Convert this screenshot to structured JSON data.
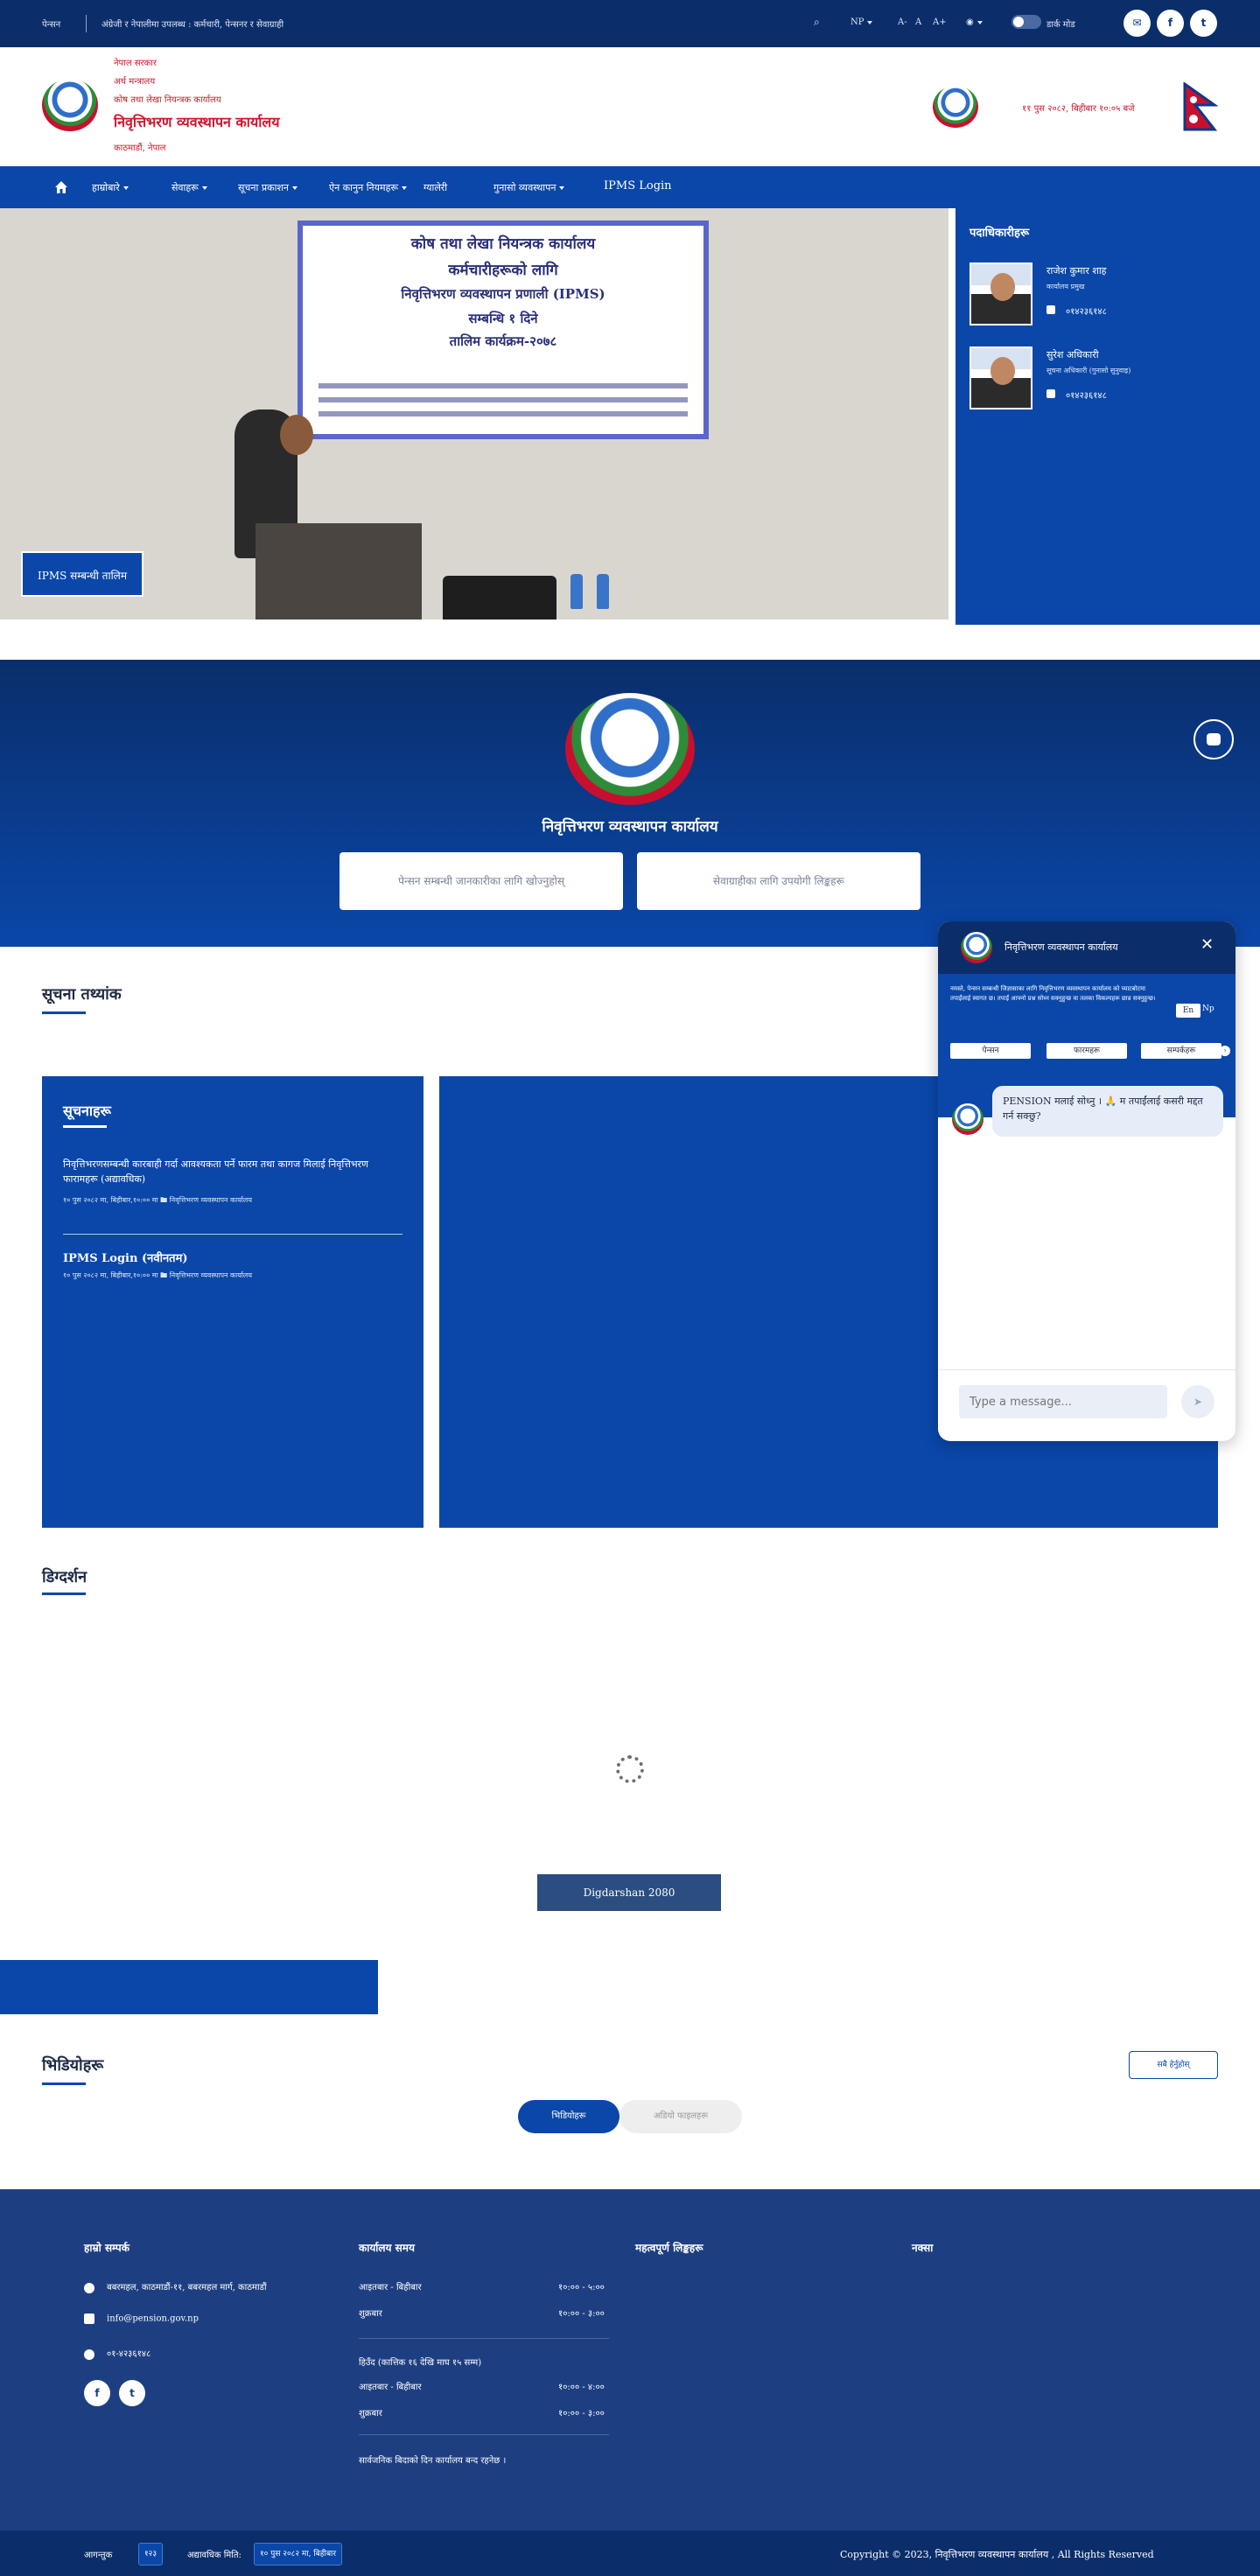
{
  "topbar": {
    "org_short": "पेन्सन",
    "notice": "अंग्रेजी र नेपालीमा उपलब्ध : कर्मचारी, पेन्सनर र सेवाग्राही",
    "lang": "NP",
    "font_minus": "A-",
    "font_normal": "A",
    "font_plus": "A+",
    "theme_label": "डार्क मोड",
    "mail_icon": "mail-icon",
    "facebook_icon": "facebook-icon",
    "twitter_icon": "twitter-icon"
  },
  "header": {
    "line1": "नेपाल सरकार",
    "line2": "अर्थ मन्त्रालय",
    "line3": "कोष तथा लेखा नियन्त्रक कार्यालय",
    "title": "निवृत्तिभरण व्यवस्थापन कार्यालय",
    "line5": "काठमाडौं, नेपाल",
    "date_time": "११ पुस २०८२, बिहीबार १०:०५ बजे"
  },
  "nav": {
    "home_icon": "home-icon",
    "items": [
      {
        "label": "हाम्रोबारे",
        "dropdown": true
      },
      {
        "label": "सेवाहरू",
        "dropdown": true
      },
      {
        "label": "सूचना प्रकाशन",
        "dropdown": true
      },
      {
        "label": "ऐन कानुन नियमहरू",
        "dropdown": true
      },
      {
        "label": "ग्यालेरी",
        "dropdown": false
      },
      {
        "label": "गुनासो व्यवस्थापन",
        "dropdown": true
      },
      {
        "label": "IPMS Login",
        "dropdown": false
      }
    ]
  },
  "hero": {
    "banner_line1": "कोष तथा लेखा नियन्त्रक कार्यालय",
    "banner_line2": "कर्मचारीहरूको लागि",
    "banner_line3": "निवृत्तिभरण व्यवस्थापन प्रणाली (IPMS)",
    "banner_line4": "सम्बन्धि १ दिने",
    "banner_line5": "तालिम कार्यक्रम-२०७८",
    "caption": "IPMS सम्बन्धी तालिम"
  },
  "officials": {
    "title": "पदाधिकारीहरू",
    "people": [
      {
        "name": "राजेश कुमार शाह",
        "role": "कार्यालय प्रमुख",
        "phone": "०१४२३६१४८"
      },
      {
        "name": "सुरेश अधिकारी",
        "role": "सूचना अधिकारी (गुनासो सुनुवाइ)",
        "phone": "०१४२३६१४८"
      }
    ]
  },
  "search_section": {
    "title": "निवृत्तिभरण व्यवस्थापन कार्यालय",
    "box1": "पेन्सन सम्बन्धी जानकारीका लागि खोज्नुहोस्",
    "box2": "सेवाग्राहीका लागि उपयोगी लिङ्कहरू",
    "chat_icon": "chatbot-icon"
  },
  "news": {
    "title": "सूचना तथ्यांक",
    "card_title": "सूचनाहरू",
    "items": [
      {
        "title": "निवृत्तिभरणसम्बन्धी कारबाही गर्दा आवश्यकता पर्ने फारम तथा कागज मिलाई निवृत्तिभरण फारामहरू (अद्यावधिक)",
        "date": "१० पुस २०८२ मा, बिहीबार,१०:०० मा",
        "source": "निवृत्तिभरण व्यवस्थापन कार्यालय"
      },
      {
        "title": "IPMS Login (नवीनतम)",
        "date": "१० पुस २०८२ मा, बिहीबार,१०:०० मा",
        "source": "निवृत्तिभरण व्यवस्थापन कार्यालय"
      }
    ]
  },
  "gallery": {
    "title": "डिग्दर्शन",
    "button": "Digdarshan 2080"
  },
  "videos": {
    "title": "भिडियोहरू",
    "view_all": "सबै हेर्नुहोस्",
    "tab_active": "भिडियोहरू",
    "tab_inactive": "अडियो फाइलहरू"
  },
  "chat": {
    "title": "निवृत्तिभरण व्यवस्थापन कार्यालय",
    "intro": "नमस्ते, पेन्सन सम्बन्धी जिज्ञासाका लागि निवृत्तिभरण व्यवस्थापन कार्यालय को च्याटबोटमा तपाईंलाई स्वागत छ। तपाईं आफ्नो प्रश्न सोध्न सक्नुहुन्छ वा तलका विकल्पहरू छान्न सक्नुहुन्छ।",
    "lang_en": "En",
    "lang_np": "Np",
    "options": [
      "पेन्सन",
      "फारमहरू",
      "सम्पर्कहरू"
    ],
    "greeting": "PENSION मलाई सोध्नु । 🙏 म तपाईंलाई कसरी मद्दत गर्न सक्छु?",
    "placeholder": "Type a message...",
    "send_icon": "send-icon",
    "close_icon": "close-icon"
  },
  "footer": {
    "col1_title": "हाम्रो सम्पर्क",
    "address": "बबरमहल, काठमाडौं-११, बबरमहल मार्ग, काठमाडौं",
    "email": "info@pension.gov.np",
    "phone": "०१-४२३६१४८",
    "col2_title": "कार्यालय समय",
    "hours": [
      {
        "day": "आइतबार - बिहीबार",
        "time": "१०:०० - ५:००"
      },
      {
        "day": "शुक्रबार",
        "time": "१०:०० - ३:००"
      }
    ],
    "winter_title": "हिउँद (कात्तिक १६ देखि माघ १५ सम्म)",
    "winter_hours": [
      {
        "day": "आइतबार - बिहीबार",
        "time": "१०:०० - ४:००"
      },
      {
        "day": "शुक्रबार",
        "time": "१०:०० - ३:००"
      }
    ],
    "holiday_note": "सार्वजनिक बिदाको दिन कार्यालय बन्द रहनेछ ।",
    "col3_title": "महत्वपूर्ण लिङ्कहरू",
    "col4_title": "नक्सा"
  },
  "bottombar": {
    "visitors_label": "आगन्तुक",
    "visitors_value": "१२३",
    "updated_label": "अद्यावधिक मिति:",
    "updated_value": "१० पुस २०८२ मा, बिहीबार",
    "copyright": "Copyright © 2023, निवृत्तिभरण व्यवस्थापन कार्यालय , All Rights Reserved"
  },
  "colors": {
    "primary": "#0a47a9",
    "dark": "#0b2e6b",
    "accent_red": "#d0152b",
    "footer": "#1d3f82"
  }
}
